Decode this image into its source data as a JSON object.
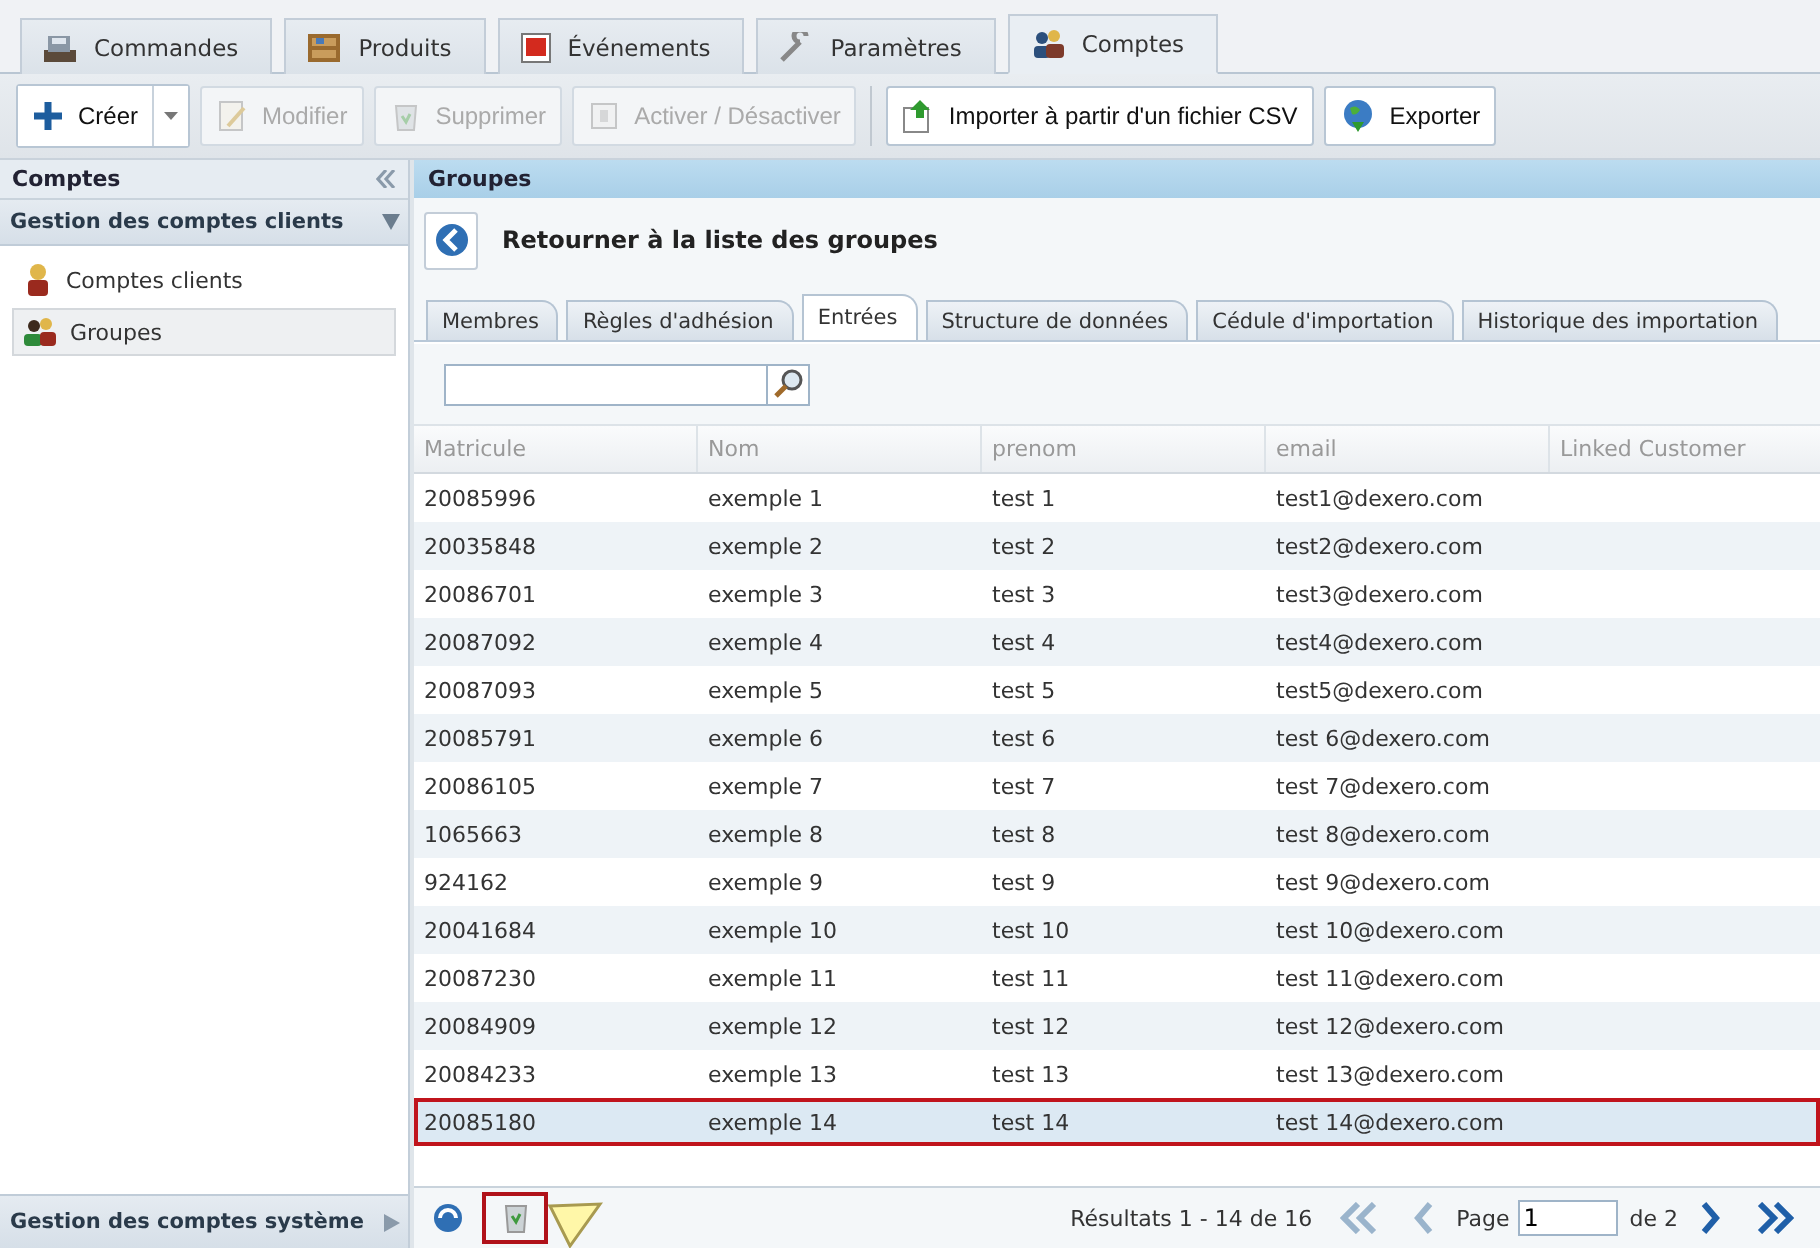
{
  "main_tabs": [
    {
      "label": "Commandes",
      "selected": false
    },
    {
      "label": "Produits",
      "selected": false
    },
    {
      "label": "Événements",
      "selected": false
    },
    {
      "label": "Paramètres",
      "selected": false
    },
    {
      "label": "Comptes",
      "selected": true
    }
  ],
  "toolbar": [
    {
      "label": "Créer",
      "kind": "split"
    },
    {
      "label": "Modifier",
      "kind": "button",
      "disabled": true
    },
    {
      "label": "Supprimer",
      "kind": "button",
      "disabled": true
    },
    {
      "label": "Activer / Désactiver",
      "kind": "button",
      "disabled": true
    },
    {
      "kind": "separator"
    },
    {
      "label": "Importer à partir d'un fichier CSV",
      "kind": "button",
      "disabled": false
    },
    {
      "label": "Exporter",
      "kind": "button",
      "disabled": false
    }
  ],
  "sidebar": {
    "title": "Comptes",
    "section": "Gestion des comptes clients",
    "items": [
      {
        "label": "Comptes clients",
        "selected": false
      },
      {
        "label": "Groupes",
        "selected": true
      }
    ],
    "bottom_section": "Gestion des comptes système"
  },
  "panel": {
    "title": "Groupes",
    "back_label": "Retourner à la liste des groupes",
    "tabs": [
      {
        "label": "Membres",
        "selected": false
      },
      {
        "label": "Règles d'adhésion",
        "selected": false
      },
      {
        "label": "Entrées",
        "selected": true
      },
      {
        "label": "Structure de données",
        "selected": false
      },
      {
        "label": "Cédule d'importation",
        "selected": false
      },
      {
        "label": "Historique des importation",
        "selected": false
      }
    ],
    "table": {
      "columns": [
        "Matricule",
        "Nom",
        "prenom",
        "email",
        "Linked Customer"
      ],
      "rows": [
        {
          "cells": [
            "20085996",
            "exemple 1",
            "test 1",
            "test1@dexero.com"
          ],
          "selected": false,
          "highlighted": false
        },
        {
          "cells": [
            "20035848",
            "exemple 2",
            "test 2",
            "test2@dexero.com"
          ],
          "selected": false,
          "highlighted": false
        },
        {
          "cells": [
            "20086701",
            "exemple 3",
            "test 3",
            "test3@dexero.com"
          ],
          "selected": false,
          "highlighted": false
        },
        {
          "cells": [
            "20087092",
            "exemple 4",
            "test 4",
            "test4@dexero.com"
          ],
          "selected": false,
          "highlighted": false
        },
        {
          "cells": [
            "20087093",
            "exemple 5",
            "test 5",
            "test5@dexero.com"
          ],
          "selected": false,
          "highlighted": false
        },
        {
          "cells": [
            "20085791",
            "exemple 6",
            "test 6",
            "test 6@dexero.com"
          ],
          "selected": false,
          "highlighted": false
        },
        {
          "cells": [
            "20086105",
            "exemple 7",
            "test 7",
            "test 7@dexero.com"
          ],
          "selected": false,
          "highlighted": false
        },
        {
          "cells": [
            "1065663",
            "exemple 8",
            "test 8",
            "test 8@dexero.com"
          ],
          "selected": false,
          "highlighted": false
        },
        {
          "cells": [
            "924162",
            "exemple 9",
            "test 9",
            "test 9@dexero.com"
          ],
          "selected": false,
          "highlighted": false
        },
        {
          "cells": [
            "20041684",
            "exemple 10",
            "test 10",
            "test 10@dexero.com"
          ],
          "selected": false,
          "highlighted": false
        },
        {
          "cells": [
            "20087230",
            "exemple 11",
            "test 11",
            "test 11@dexero.com"
          ],
          "selected": false,
          "highlighted": false
        },
        {
          "cells": [
            "20084909",
            "exemple 12",
            "test 12",
            "test 12@dexero.com"
          ],
          "selected": false,
          "highlighted": false
        },
        {
          "cells": [
            "20084233",
            "exemple 13",
            "test 13",
            "test 13@dexero.com"
          ],
          "selected": false,
          "highlighted": false
        },
        {
          "cells": [
            "20085180",
            "exemple 14",
            "test 14",
            "test 14@dexero.com"
          ],
          "selected": true,
          "highlighted": true
        }
      ]
    },
    "footer": {
      "delete_highlighted": true,
      "results": "Résultats 1 - 14 de 16",
      "page_label": "Page",
      "page_value": "1",
      "page_total": "de 2"
    }
  }
}
